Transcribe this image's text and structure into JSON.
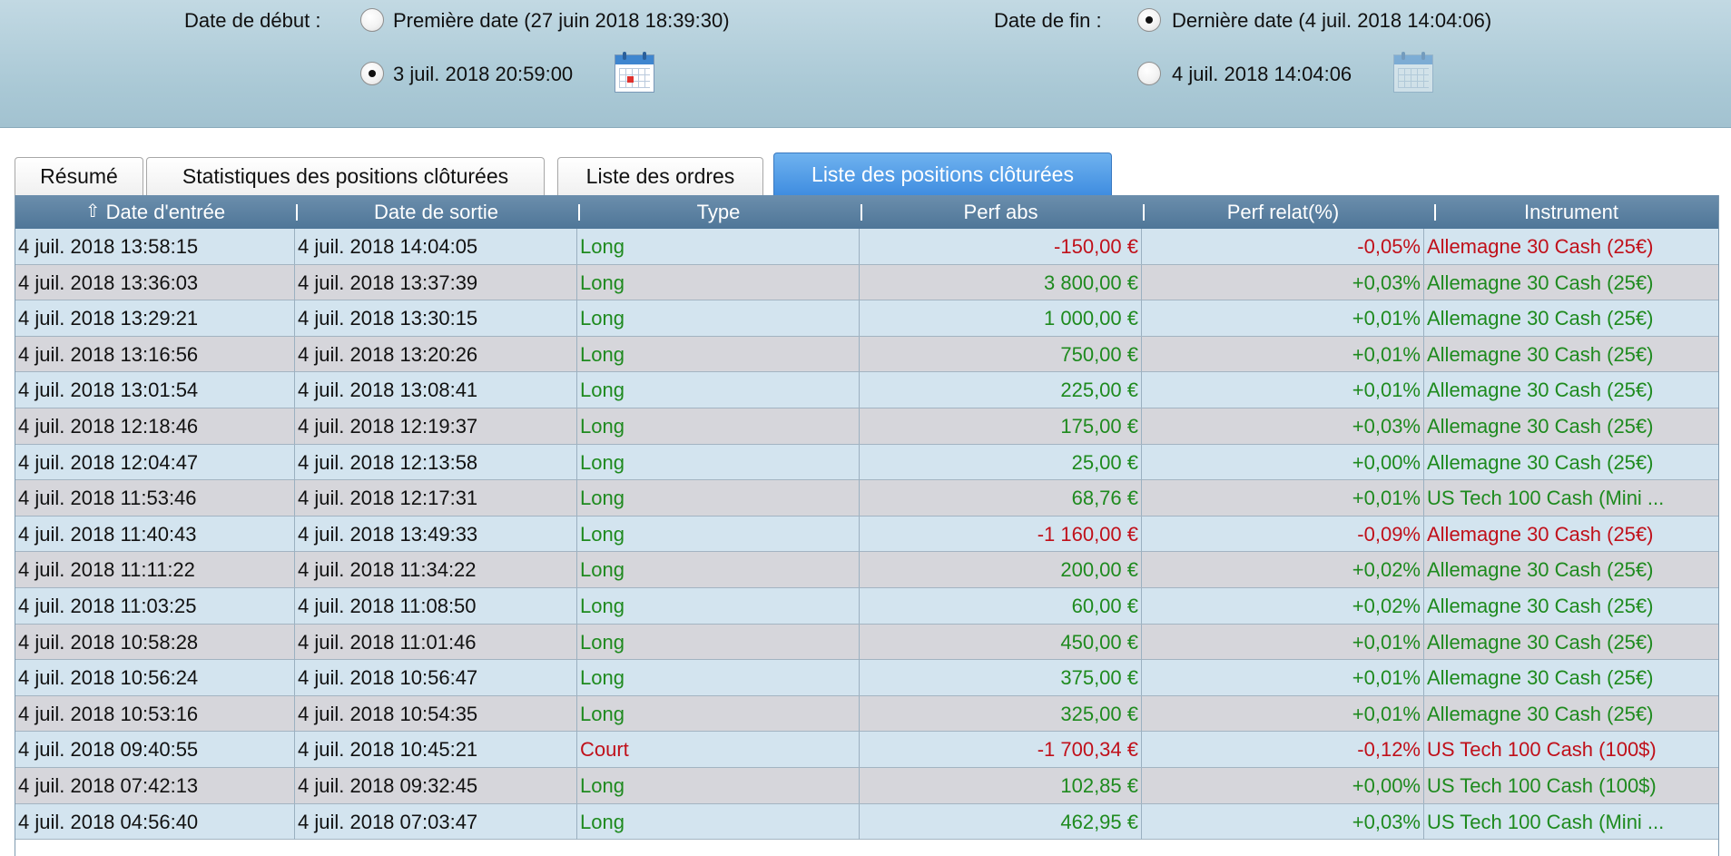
{
  "filter": {
    "start_label": "Date de début :",
    "start_option_first": "Première date (27 juin 2018 18:39:30)",
    "start_option_custom": "3 juil. 2018 20:59:00",
    "start_selected": "custom",
    "end_label": "Date de fin :",
    "end_option_last": "Dernière date (4 juil. 2018 14:04:06)",
    "end_option_custom": "4 juil. 2018 14:04:06",
    "end_selected": "last"
  },
  "tabs": [
    {
      "label": "Résumé",
      "active": false
    },
    {
      "label": "Statistiques des positions clôturées",
      "active": false
    },
    {
      "label": "Liste des ordres",
      "active": false
    },
    {
      "label": "Liste des positions clôturées",
      "active": true
    }
  ],
  "table": {
    "sort_icon": "arrow-up-icon",
    "columns": [
      "Date d'entrée",
      "Date de sortie",
      "Type",
      "Perf abs",
      "Perf relat(%)",
      "Instrument"
    ],
    "rows": [
      {
        "entry": "4 juil. 2018 13:58:15",
        "exit": "4 juil. 2018 14:04:05",
        "type": "Long",
        "abs": "-150,00 €",
        "rel": "-0,05%",
        "instrument": "Allemagne 30 Cash (25€)",
        "tone": "neg"
      },
      {
        "entry": "4 juil. 2018 13:36:03",
        "exit": "4 juil. 2018 13:37:39",
        "type": "Long",
        "abs": "3 800,00 €",
        "rel": "+0,03%",
        "instrument": "Allemagne 30 Cash (25€)",
        "tone": "pos"
      },
      {
        "entry": "4 juil. 2018 13:29:21",
        "exit": "4 juil. 2018 13:30:15",
        "type": "Long",
        "abs": "1 000,00 €",
        "rel": "+0,01%",
        "instrument": "Allemagne 30 Cash (25€)",
        "tone": "pos"
      },
      {
        "entry": "4 juil. 2018 13:16:56",
        "exit": "4 juil. 2018 13:20:26",
        "type": "Long",
        "abs": "750,00 €",
        "rel": "+0,01%",
        "instrument": "Allemagne 30 Cash (25€)",
        "tone": "pos"
      },
      {
        "entry": "4 juil. 2018 13:01:54",
        "exit": "4 juil. 2018 13:08:41",
        "type": "Long",
        "abs": "225,00 €",
        "rel": "+0,01%",
        "instrument": "Allemagne 30 Cash (25€)",
        "tone": "pos"
      },
      {
        "entry": "4 juil. 2018 12:18:46",
        "exit": "4 juil. 2018 12:19:37",
        "type": "Long",
        "abs": "175,00 €",
        "rel": "+0,03%",
        "instrument": "Allemagne 30 Cash (25€)",
        "tone": "pos"
      },
      {
        "entry": "4 juil. 2018 12:04:47",
        "exit": "4 juil. 2018 12:13:58",
        "type": "Long",
        "abs": "25,00 €",
        "rel": "+0,00%",
        "instrument": "Allemagne 30 Cash (25€)",
        "tone": "pos"
      },
      {
        "entry": "4 juil. 2018 11:53:46",
        "exit": "4 juil. 2018 12:17:31",
        "type": "Long",
        "abs": "68,76 €",
        "rel": "+0,01%",
        "instrument": "US Tech 100 Cash (Mini ...",
        "tone": "pos"
      },
      {
        "entry": "4 juil. 2018 11:40:43",
        "exit": "4 juil. 2018 13:49:33",
        "type": "Long",
        "abs": "-1 160,00 €",
        "rel": "-0,09%",
        "instrument": "Allemagne 30 Cash (25€)",
        "tone": "neg"
      },
      {
        "entry": "4 juil. 2018 11:11:22",
        "exit": "4 juil. 2018 11:34:22",
        "type": "Long",
        "abs": "200,00 €",
        "rel": "+0,02%",
        "instrument": "Allemagne 30 Cash (25€)",
        "tone": "pos"
      },
      {
        "entry": "4 juil. 2018 11:03:25",
        "exit": "4 juil. 2018 11:08:50",
        "type": "Long",
        "abs": "60,00 €",
        "rel": "+0,02%",
        "instrument": "Allemagne 30 Cash (25€)",
        "tone": "pos"
      },
      {
        "entry": "4 juil. 2018 10:58:28",
        "exit": "4 juil. 2018 11:01:46",
        "type": "Long",
        "abs": "450,00 €",
        "rel": "+0,01%",
        "instrument": "Allemagne 30 Cash (25€)",
        "tone": "pos"
      },
      {
        "entry": "4 juil. 2018 10:56:24",
        "exit": "4 juil. 2018 10:56:47",
        "type": "Long",
        "abs": "375,00 €",
        "rel": "+0,01%",
        "instrument": "Allemagne 30 Cash (25€)",
        "tone": "pos"
      },
      {
        "entry": "4 juil. 2018 10:53:16",
        "exit": "4 juil. 2018 10:54:35",
        "type": "Long",
        "abs": "325,00 €",
        "rel": "+0,01%",
        "instrument": "Allemagne 30 Cash (25€)",
        "tone": "pos"
      },
      {
        "entry": "4 juil. 2018 09:40:55",
        "exit": "4 juil. 2018 10:45:21",
        "type": "Court",
        "abs": "-1 700,34 €",
        "rel": "-0,12%",
        "instrument": "US Tech 100 Cash (100$)",
        "tone": "neg"
      },
      {
        "entry": "4 juil. 2018 07:42:13",
        "exit": "4 juil. 2018 09:32:45",
        "type": "Long",
        "abs": "102,85 €",
        "rel": "+0,00%",
        "instrument": "US Tech 100 Cash (100$)",
        "tone": "pos"
      },
      {
        "entry": "4 juil. 2018 04:56:40",
        "exit": "4 juil. 2018 07:03:47",
        "type": "Long",
        "abs": "462,95 €",
        "rel": "+0,03%",
        "instrument": "US Tech 100 Cash (Mini ...",
        "tone": "pos"
      }
    ]
  },
  "colors": {
    "positive": "#1e8a1e",
    "negative": "#c0101a",
    "tab_active": "#4a95e4",
    "header": "#5a7fa0"
  }
}
